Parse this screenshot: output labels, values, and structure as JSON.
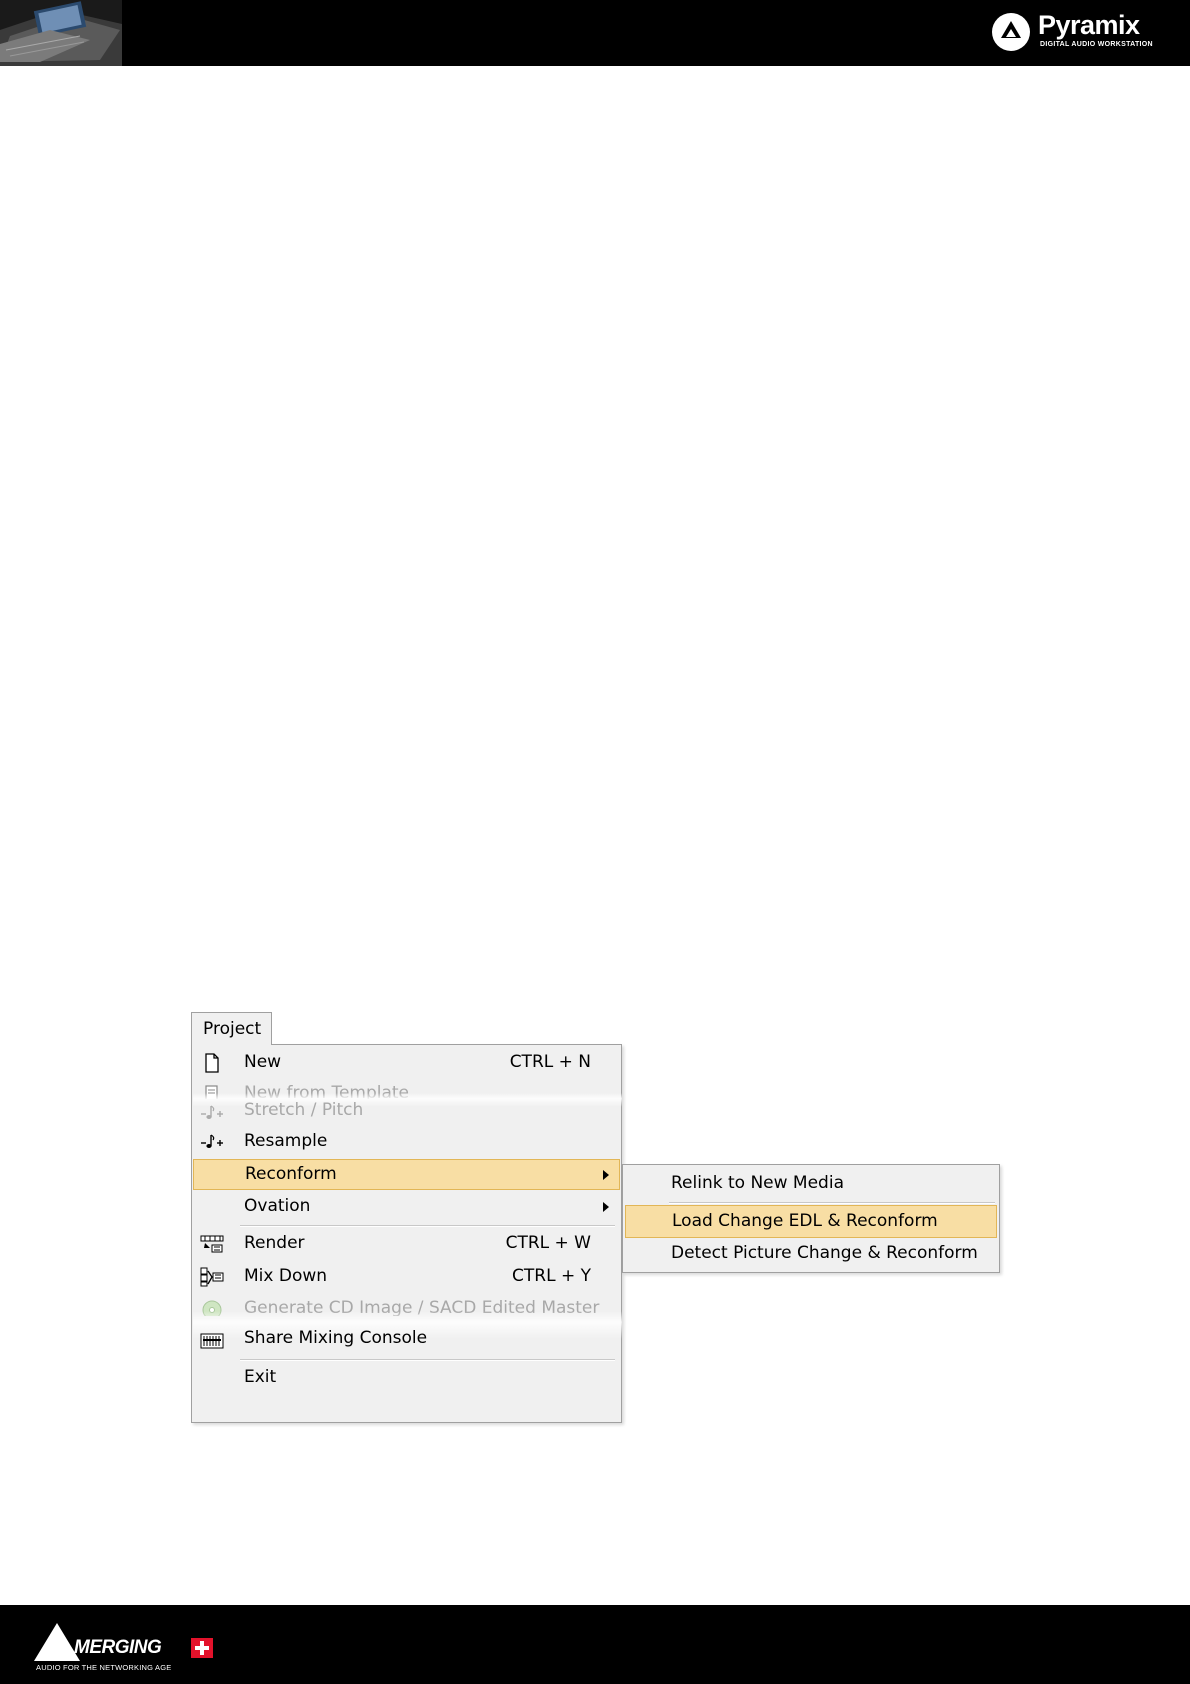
{
  "header": {
    "brand_name": "Pyramix",
    "brand_tagline": "DIGITAL AUDIO WORKSTATION"
  },
  "footer": {
    "brand_name": "MERGING",
    "brand_tagline": "AUDIO FOR THE NETWORKING AGE"
  },
  "menu": {
    "title": "Project",
    "items": [
      {
        "label": "New",
        "shortcut": "CTRL + N",
        "icon": "document-icon"
      },
      {
        "label": "New from Template",
        "icon": "template-icon"
      },
      {
        "label": "Stretch / Pitch",
        "icon": "note-icon"
      },
      {
        "label": "Resample",
        "icon": "note-icon"
      },
      {
        "label": "Reconform"
      },
      {
        "label": "Ovation"
      },
      {
        "label": "Render",
        "shortcut": "CTRL + W",
        "icon": "render-icon"
      },
      {
        "label": "Mix Down",
        "shortcut": "CTRL + Y",
        "icon": "mixdown-icon"
      },
      {
        "label": "Generate CD Image / SACD Edited Master",
        "icon": "cd-icon"
      },
      {
        "label": "Share Mixing Console",
        "icon": "console-icon"
      },
      {
        "label": "Exit"
      }
    ],
    "submenu": [
      {
        "label": "Relink to New Media"
      },
      {
        "label": "Load Change EDL & Reconform"
      },
      {
        "label": "Detect Picture Change & Reconform"
      }
    ]
  },
  "colors": {
    "highlight_fill": "#f8dea4",
    "highlight_border": "#e2b656",
    "menu_bg": "#f0f0f0",
    "bar_bg": "#000000",
    "brand_red": "#e3122b"
  }
}
